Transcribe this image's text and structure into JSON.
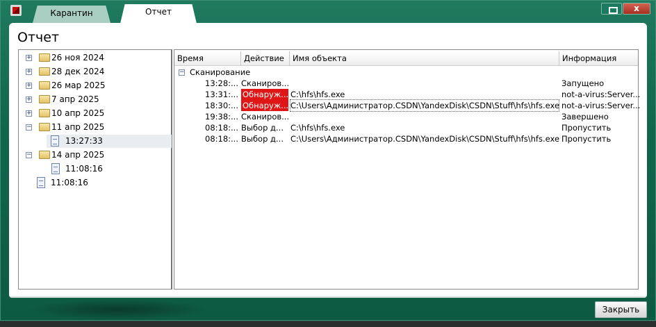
{
  "tabs": [
    {
      "label": "Карантин"
    },
    {
      "label": "Отчет"
    }
  ],
  "page_title": "Отчет",
  "tree": [
    {
      "label": "26 ноя 2024",
      "type": "folder",
      "expanded": false
    },
    {
      "label": "28 дек 2024",
      "type": "folder",
      "expanded": false
    },
    {
      "label": "26 мар 2025",
      "type": "folder",
      "expanded": false
    },
    {
      "label": "7 апр 2025",
      "type": "folder",
      "expanded": false
    },
    {
      "label": "10 апр 2025",
      "type": "folder",
      "expanded": false
    },
    {
      "label": "11 апр 2025",
      "type": "folder",
      "expanded": true
    },
    {
      "label": "13:27:33",
      "type": "file",
      "selected": true
    },
    {
      "label": "14 апр 2025",
      "type": "folder",
      "expanded": true
    },
    {
      "label": "11:08:16",
      "type": "file"
    },
    {
      "label": "11:08:16",
      "type": "file"
    }
  ],
  "columns": [
    "Время",
    "Действие",
    "Имя объекта",
    "Информация"
  ],
  "group": "Сканирование",
  "rows": [
    {
      "time": "13:28:...",
      "action": "Сканиров...",
      "object": "",
      "info": "Запущено"
    },
    {
      "time": "13:31:...",
      "action": "Обнаруж...",
      "object": "C:\\hfs\\hfs.exe",
      "info": "not-a-virus:Server..."
    },
    {
      "time": "18:30:...",
      "action": "Обнаруж...",
      "object": "C:\\Users\\Администратор.CSDN\\YandexDisk\\CSDN\\Stuff\\hfs\\hfs.exe",
      "info": "not-a-virus:Server..."
    },
    {
      "time": "19:38:...",
      "action": "Сканиров...",
      "object": "",
      "info": "Завершено"
    },
    {
      "time": "08:18:...",
      "action": "Выбор д...",
      "object": "C:\\hfs\\hfs.exe",
      "info": "Пропустить"
    },
    {
      "time": "08:18:...",
      "action": "Выбор д...",
      "object": "C:\\Users\\Администратор.CSDN\\YandexDisk\\CSDN\\Stuff\\hfs\\hfs.exe",
      "info": "Пропустить"
    }
  ],
  "close_button": "Закрыть",
  "colors": {
    "frame": "#11664c",
    "detected": "#e01515"
  }
}
